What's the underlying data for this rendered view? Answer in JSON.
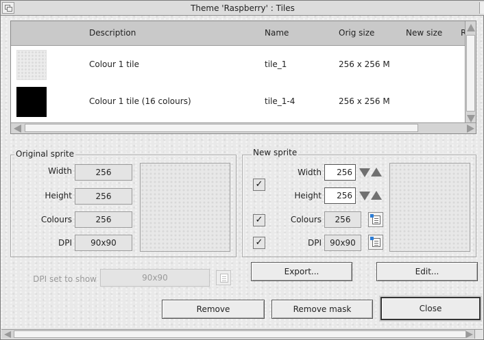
{
  "window": {
    "title": "Theme 'Raspberry' : Tiles"
  },
  "table": {
    "headers": {
      "description": "Description",
      "name": "Name",
      "orig_size": "Orig size",
      "new_size": "New size",
      "partial": "R"
    },
    "rows": [
      {
        "description": "Colour 1 tile",
        "name": "tile_1",
        "orig_size": "256 x 256 M",
        "new_size": "",
        "thumb": "light"
      },
      {
        "description": "Colour 1 tile (16 colours)",
        "name": "tile_1-4",
        "orig_size": "256 x 256 M",
        "new_size": "",
        "thumb": "dark"
      }
    ]
  },
  "original_sprite": {
    "group_label": "Original sprite",
    "width_label": "Width",
    "width_value": "256",
    "height_label": "Height",
    "height_value": "256",
    "colours_label": "Colours",
    "colours_value": "256",
    "dpi_label": "DPI",
    "dpi_value": "90x90"
  },
  "dpi_set": {
    "label": "DPI set to show",
    "value": "90x90"
  },
  "new_sprite": {
    "group_label": "New sprite",
    "width_label": "Width",
    "width_value": "256",
    "height_label": "Height",
    "height_value": "256",
    "colours_label": "Colours",
    "colours_value": "256",
    "dpi_label": "DPI",
    "dpi_value": "90x90",
    "size_checked": true,
    "colours_checked": true,
    "dpi_checked": true,
    "check_glyph": "✓"
  },
  "buttons": {
    "export": "Export...",
    "edit": "Edit...",
    "remove": "Remove",
    "remove_mask": "Remove mask",
    "close": "Close"
  },
  "icons": {
    "back": "window-back-icon",
    "close": "window-close-icon",
    "menu": "menu-icon"
  },
  "colors": {
    "window_bg": "#e9e9e9",
    "table_header_bg": "#c9c9c9",
    "arrow_gray": "#707070",
    "icon_accent": "#2b7cd6"
  }
}
